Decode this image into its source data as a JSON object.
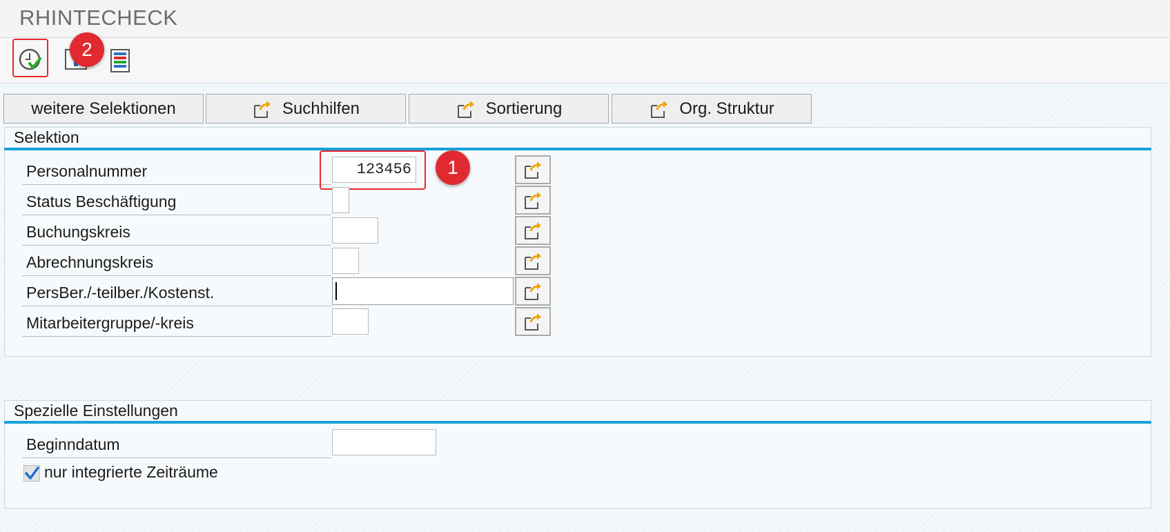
{
  "app": {
    "title": "RHINTECHECK"
  },
  "toolbar": {
    "execute_icon": "execute-clock-check-icon",
    "info_icon": "info-icon",
    "layout_icon": "layout-list-icon"
  },
  "callouts": {
    "one": "1",
    "two": "2"
  },
  "tabs": [
    {
      "label": "weitere Selektionen",
      "icon": ""
    },
    {
      "label": "Suchhilfen",
      "icon": "export-arrow-icon"
    },
    {
      "label": "Sortierung",
      "icon": "export-arrow-icon"
    },
    {
      "label": "Org. Struktur",
      "icon": "export-arrow-icon"
    }
  ],
  "selektion": {
    "title": "Selektion",
    "rows": [
      {
        "label": "Personalnummer",
        "value": "123456"
      },
      {
        "label": "Status Beschäftigung",
        "value": ""
      },
      {
        "label": "Buchungskreis",
        "value": ""
      },
      {
        "label": "Abrechnungskreis",
        "value": ""
      },
      {
        "label": "PersBer./-teilber./Kostenst.",
        "value": ""
      },
      {
        "label": "Mitarbeitergruppe/-kreis",
        "value": ""
      }
    ]
  },
  "spezielle": {
    "title": "Spezielle Einstellungen",
    "begin_label": "Beginndatum",
    "begin_value": "",
    "checkbox_label": "nur integrierte Zeiträume",
    "checkbox_checked": true
  },
  "colors": {
    "accent": "#1aa0d8",
    "highlight": "#e8262e",
    "callout": "#e02a2f"
  }
}
